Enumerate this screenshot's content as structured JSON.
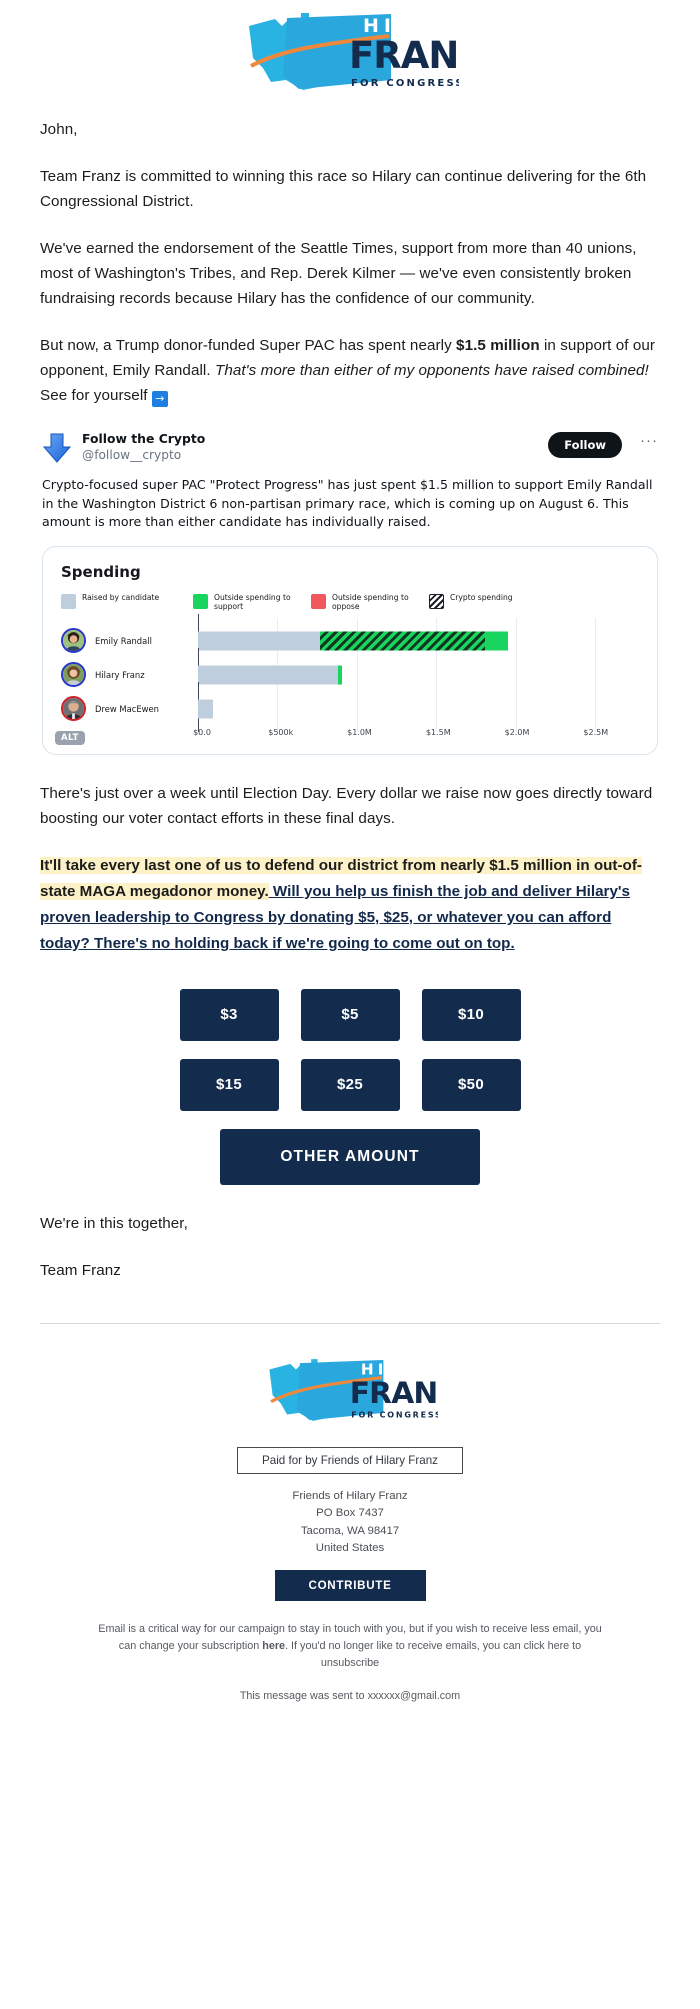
{
  "brand": {
    "line1": "HILARY",
    "line2": "FRANZ",
    "line3": "FOR CONGRESS (D)",
    "navy": "#132b4d",
    "light_blue": "#29b3e3",
    "mid_blue": "#1f9bd4",
    "orange": "#f0883c"
  },
  "greeting": "John,",
  "paragraphs": {
    "p1": "Team Franz is committed to winning this race so Hilary can continue delivering for the 6th Congressional District.",
    "p2": "We've earned the endorsement of the Seattle Times, support from more than 40 unions, most of Washington's Tribes, and Rep. Derek Kilmer — we've even consistently broken fundraising records because Hilary has the confidence of our community.",
    "p3_a": "But now, a Trump donor-funded Super PAC has spent nearly ",
    "p3_bold": "$1.5 million",
    "p3_b": " in support of our opponent, Emily Randall. ",
    "p3_ital": "That's more than either of my opponents have raised combined!",
    "p3_c": " See for yourself ",
    "p3_arrow": "→",
    "p4": "There's just over a week until Election Day. Every dollar we raise now goes directly toward boosting our voter contact efforts in these final days."
  },
  "highlight": {
    "hl_a": "It'll take every last one of us to defend our district from nearly ",
    "hl_b": "$1.5 million in out-of-state MAGA megadonor money.",
    "link": " Will you help us finish the job and deliver Hilary's proven leadership to Congress by donating $5, $25, or whatever you can afford today?",
    "tail": " There's no holding back if we're going to come out on top.",
    "highlight_color": "#fdf2c7"
  },
  "tweet": {
    "avatar_icon": "down-arrow-emoji",
    "display_name": "Follow the Crypto",
    "handle": "@follow__crypto",
    "follow_label": "Follow",
    "more_label": "···",
    "text": "Crypto-focused super PAC \"Protect Progress\" has just spent $1.5 million to support Emily Randall in the Washington District 6 non-partisan primary race, which is coming up on August 6. This amount is more than either candidate has individually raised.",
    "alt_badge": "ALT"
  },
  "chart_data": {
    "type": "bar",
    "orientation": "horizontal",
    "stacked": true,
    "title": "Spending",
    "xlabel": "",
    "ylabel": "",
    "xlim": [
      0,
      2800000
    ],
    "xticks": [
      0,
      500000,
      1000000,
      1500000,
      2000000,
      2500000
    ],
    "xtick_labels": [
      "$0.0",
      "$500k",
      "$1.0M",
      "$1.5M",
      "$2.0M",
      "$2.5M"
    ],
    "grid": true,
    "legend_position": "top",
    "legend": [
      {
        "label": "Raised by candidate",
        "color": "#bfcedd",
        "pattern": "solid"
      },
      {
        "label": "Outside spending to support",
        "color": "#19d45e",
        "pattern": "solid"
      },
      {
        "label": "Outside spending to oppose",
        "color": "#f0585e",
        "pattern": "solid"
      },
      {
        "label": "Crypto spending",
        "color": "#1b1f24",
        "pattern": "hatch"
      }
    ],
    "categories": [
      "Emily Randall",
      "Hilary Franz",
      "Drew MacEwen"
    ],
    "series": [
      {
        "name": "Raised by candidate",
        "values": [
          980000,
          1130000,
          120000
        ]
      },
      {
        "name": "Crypto spending",
        "values": [
          1320000,
          0,
          0
        ]
      },
      {
        "name": "Outside spending to support",
        "values": [
          180000,
          25000,
          0
        ]
      },
      {
        "name": "Outside spending to oppose",
        "values": [
          0,
          0,
          0
        ]
      }
    ]
  },
  "donation": {
    "rows": [
      [
        "$3",
        "$5",
        "$10"
      ],
      [
        "$15",
        "$25",
        "$50"
      ]
    ],
    "other_label": "OTHER AMOUNT"
  },
  "signoff": {
    "line1": "We're in this together,",
    "line2": "Team Franz"
  },
  "footer": {
    "paid_for": "Paid for by Friends of Hilary Franz",
    "org": "Friends of Hilary Franz",
    "po_box": "PO Box 7437",
    "city": "Tacoma, WA 98417",
    "country": "United States",
    "contribute_label": "CONTRIBUTE",
    "legal_a": "Email is a critical way for our campaign to stay in touch with you, but if you wish to receive less email, you can change your subscription ",
    "legal_link": "here",
    "legal_b": ". If you'd no longer like to receive emails, you can click here to unsubscribe",
    "sent_to": "This message was sent to xxxxxx@gmail.com"
  }
}
